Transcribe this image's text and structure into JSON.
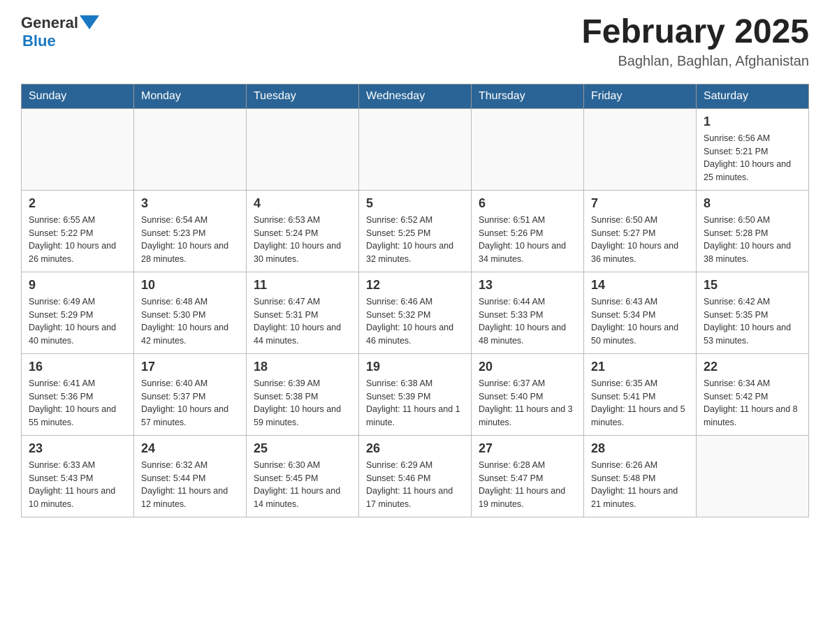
{
  "header": {
    "logo": {
      "general": "General",
      "blue": "Blue"
    },
    "title": "February 2025",
    "location": "Baghlan, Baghlan, Afghanistan"
  },
  "weekdays": [
    "Sunday",
    "Monday",
    "Tuesday",
    "Wednesday",
    "Thursday",
    "Friday",
    "Saturday"
  ],
  "weeks": [
    [
      {
        "day": "",
        "info": ""
      },
      {
        "day": "",
        "info": ""
      },
      {
        "day": "",
        "info": ""
      },
      {
        "day": "",
        "info": ""
      },
      {
        "day": "",
        "info": ""
      },
      {
        "day": "",
        "info": ""
      },
      {
        "day": "1",
        "info": "Sunrise: 6:56 AM\nSunset: 5:21 PM\nDaylight: 10 hours and 25 minutes."
      }
    ],
    [
      {
        "day": "2",
        "info": "Sunrise: 6:55 AM\nSunset: 5:22 PM\nDaylight: 10 hours and 26 minutes."
      },
      {
        "day": "3",
        "info": "Sunrise: 6:54 AM\nSunset: 5:23 PM\nDaylight: 10 hours and 28 minutes."
      },
      {
        "day": "4",
        "info": "Sunrise: 6:53 AM\nSunset: 5:24 PM\nDaylight: 10 hours and 30 minutes."
      },
      {
        "day": "5",
        "info": "Sunrise: 6:52 AM\nSunset: 5:25 PM\nDaylight: 10 hours and 32 minutes."
      },
      {
        "day": "6",
        "info": "Sunrise: 6:51 AM\nSunset: 5:26 PM\nDaylight: 10 hours and 34 minutes."
      },
      {
        "day": "7",
        "info": "Sunrise: 6:50 AM\nSunset: 5:27 PM\nDaylight: 10 hours and 36 minutes."
      },
      {
        "day": "8",
        "info": "Sunrise: 6:50 AM\nSunset: 5:28 PM\nDaylight: 10 hours and 38 minutes."
      }
    ],
    [
      {
        "day": "9",
        "info": "Sunrise: 6:49 AM\nSunset: 5:29 PM\nDaylight: 10 hours and 40 minutes."
      },
      {
        "day": "10",
        "info": "Sunrise: 6:48 AM\nSunset: 5:30 PM\nDaylight: 10 hours and 42 minutes."
      },
      {
        "day": "11",
        "info": "Sunrise: 6:47 AM\nSunset: 5:31 PM\nDaylight: 10 hours and 44 minutes."
      },
      {
        "day": "12",
        "info": "Sunrise: 6:46 AM\nSunset: 5:32 PM\nDaylight: 10 hours and 46 minutes."
      },
      {
        "day": "13",
        "info": "Sunrise: 6:44 AM\nSunset: 5:33 PM\nDaylight: 10 hours and 48 minutes."
      },
      {
        "day": "14",
        "info": "Sunrise: 6:43 AM\nSunset: 5:34 PM\nDaylight: 10 hours and 50 minutes."
      },
      {
        "day": "15",
        "info": "Sunrise: 6:42 AM\nSunset: 5:35 PM\nDaylight: 10 hours and 53 minutes."
      }
    ],
    [
      {
        "day": "16",
        "info": "Sunrise: 6:41 AM\nSunset: 5:36 PM\nDaylight: 10 hours and 55 minutes."
      },
      {
        "day": "17",
        "info": "Sunrise: 6:40 AM\nSunset: 5:37 PM\nDaylight: 10 hours and 57 minutes."
      },
      {
        "day": "18",
        "info": "Sunrise: 6:39 AM\nSunset: 5:38 PM\nDaylight: 10 hours and 59 minutes."
      },
      {
        "day": "19",
        "info": "Sunrise: 6:38 AM\nSunset: 5:39 PM\nDaylight: 11 hours and 1 minute."
      },
      {
        "day": "20",
        "info": "Sunrise: 6:37 AM\nSunset: 5:40 PM\nDaylight: 11 hours and 3 minutes."
      },
      {
        "day": "21",
        "info": "Sunrise: 6:35 AM\nSunset: 5:41 PM\nDaylight: 11 hours and 5 minutes."
      },
      {
        "day": "22",
        "info": "Sunrise: 6:34 AM\nSunset: 5:42 PM\nDaylight: 11 hours and 8 minutes."
      }
    ],
    [
      {
        "day": "23",
        "info": "Sunrise: 6:33 AM\nSunset: 5:43 PM\nDaylight: 11 hours and 10 minutes."
      },
      {
        "day": "24",
        "info": "Sunrise: 6:32 AM\nSunset: 5:44 PM\nDaylight: 11 hours and 12 minutes."
      },
      {
        "day": "25",
        "info": "Sunrise: 6:30 AM\nSunset: 5:45 PM\nDaylight: 11 hours and 14 minutes."
      },
      {
        "day": "26",
        "info": "Sunrise: 6:29 AM\nSunset: 5:46 PM\nDaylight: 11 hours and 17 minutes."
      },
      {
        "day": "27",
        "info": "Sunrise: 6:28 AM\nSunset: 5:47 PM\nDaylight: 11 hours and 19 minutes."
      },
      {
        "day": "28",
        "info": "Sunrise: 6:26 AM\nSunset: 5:48 PM\nDaylight: 11 hours and 21 minutes."
      },
      {
        "day": "",
        "info": ""
      }
    ]
  ]
}
